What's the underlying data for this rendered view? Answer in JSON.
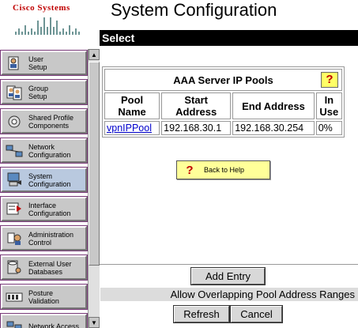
{
  "header": {
    "brand": "Cisco Systems",
    "title": "System Configuration"
  },
  "select_bar": {
    "label": "Select"
  },
  "nav": {
    "items": [
      {
        "label": "User\nSetup",
        "icon": "user-setup-icon"
      },
      {
        "label": "Group\nSetup",
        "icon": "group-setup-icon"
      },
      {
        "label": "Shared Profile\nComponents",
        "icon": "shared-profile-icon"
      },
      {
        "label": "Network\nConfiguration",
        "icon": "network-config-icon"
      },
      {
        "label": "System\nConfiguration",
        "icon": "system-config-icon",
        "active": true
      },
      {
        "label": "Interface\nConfiguration",
        "icon": "interface-config-icon"
      },
      {
        "label": "Administration\nControl",
        "icon": "admin-control-icon"
      },
      {
        "label": "External User\nDatabases",
        "icon": "external-db-icon"
      },
      {
        "label": "Posture\nValidation",
        "icon": "posture-validation-icon"
      },
      {
        "label": "Network Access",
        "icon": "network-access-icon"
      }
    ]
  },
  "pools_table": {
    "title": "AAA Server IP Pools",
    "help_glyph": "?",
    "columns": [
      "Pool\nName",
      "Start\nAddress",
      "End Address",
      "In\nUse"
    ],
    "rows": [
      {
        "pool_name": "vpnIPPool",
        "start": "192.168.30.1",
        "end": "192.168.30.254",
        "in_use": "0%"
      }
    ]
  },
  "back_to_help": {
    "label": "Back to Help",
    "glyph": "?"
  },
  "actions": {
    "add_entry": "Add Entry",
    "overlap_label": "Allow Overlapping Pool Address Ranges",
    "refresh": "Refresh",
    "cancel": "Cancel"
  },
  "colors": {
    "brand_red": "#c00000",
    "help_yellow": "#ffff66",
    "link_blue": "#0000cc"
  }
}
